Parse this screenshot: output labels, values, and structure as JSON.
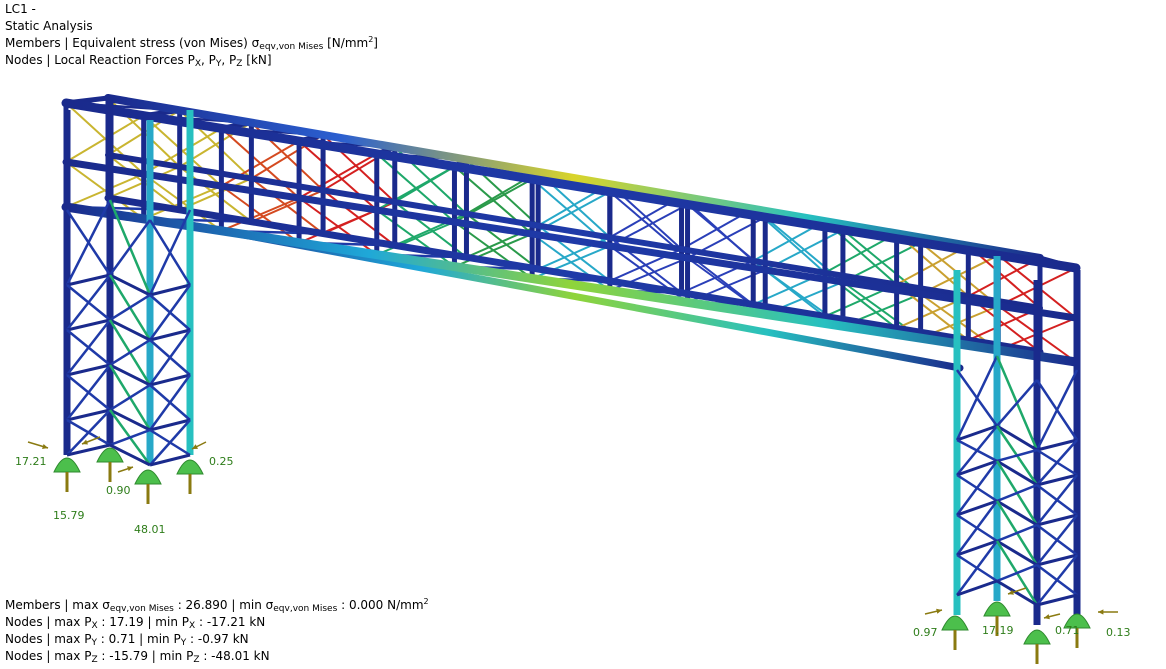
{
  "header": {
    "line1": "LC1 -",
    "line2": "Static Analysis",
    "line3": {
      "prefix": "Members | Equivalent stress (von Mises) σ",
      "sub": "eqv,von Mises",
      "unit_pre": " [N/mm",
      "unit_sup": "2",
      "unit_post": "]"
    },
    "line4": {
      "prefix": "Nodes | Local Reaction Forces P",
      "s1": "X",
      "c1": ", P",
      "s2": "Y",
      "c2": ", P",
      "s3": "Z",
      "post": " [kN]"
    }
  },
  "footer": {
    "members": {
      "a": "Members | max σ",
      "s1": "eqv,von Mises",
      "b": " : 26.890 | min σ",
      "s2": "eqv,von Mises",
      "c": " : 0.000 N/mm",
      "sup": "2"
    },
    "px": {
      "a": "Nodes | max P",
      "s1": "X",
      "b": " : 17.19 | min P",
      "s2": "X",
      "c": " : -17.21 kN"
    },
    "py": {
      "a": "Nodes | max P",
      "s1": "Y",
      "b": " : 0.71 | min P",
      "s2": "Y",
      "c": " : -0.97 kN"
    },
    "pz": {
      "a": "Nodes | max P",
      "s1": "Z",
      "b": " : -15.79 | min P",
      "s2": "Z",
      "c": " : -48.01 kN"
    }
  },
  "reactions": {
    "left": [
      "17.21",
      "0.90",
      "0.25",
      "15.79",
      "48.01"
    ],
    "right": [
      "0.97",
      "17.19",
      "0.71",
      "0.13"
    ]
  },
  "colors": {
    "text_label": "#2e7d1a",
    "support": "#4cbf4c",
    "arrow": "#8a7a10",
    "stress_low": "#1a2a8c",
    "stress_high": "#d42020"
  }
}
